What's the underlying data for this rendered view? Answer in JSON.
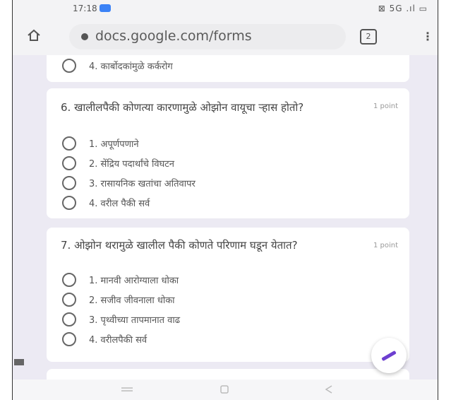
{
  "status_bar": {
    "time": "17:18",
    "right_indicators": "⊠ 5G .ıl ▭"
  },
  "browser": {
    "url": "docs.google.com/forms",
    "tab_count": "2"
  },
  "prev_card": {
    "option": "4. कार्बोदकांमुळे कर्करोग"
  },
  "questions": [
    {
      "title": "6. खालीलपैकी कोणत्या कारणामुळे ओझोन वायूचा ऱ्हास होतो?",
      "points": "1 point",
      "options": [
        "1. अपूर्णपणाने",
        "2. सेंद्रिय पदार्थांचे विघटन",
        "3. रासायनिक खतांचा अतिवापर",
        "4. वरील पैकी सर्व"
      ]
    },
    {
      "title": "7. ओझोन थरामुळे खालील पैकी कोणते परिणाम घडून येतात?",
      "points": "1 point",
      "options": [
        "1. मानवी आरोग्याला धोका",
        "2. सजीव जीवनाला धोका",
        "3. पृथ्वीच्या तापमानात वाढ",
        "4. वरीलपैकी सर्व"
      ]
    }
  ],
  "colors": {
    "accent": "#6d3fd0",
    "background": "#eceaf3"
  }
}
